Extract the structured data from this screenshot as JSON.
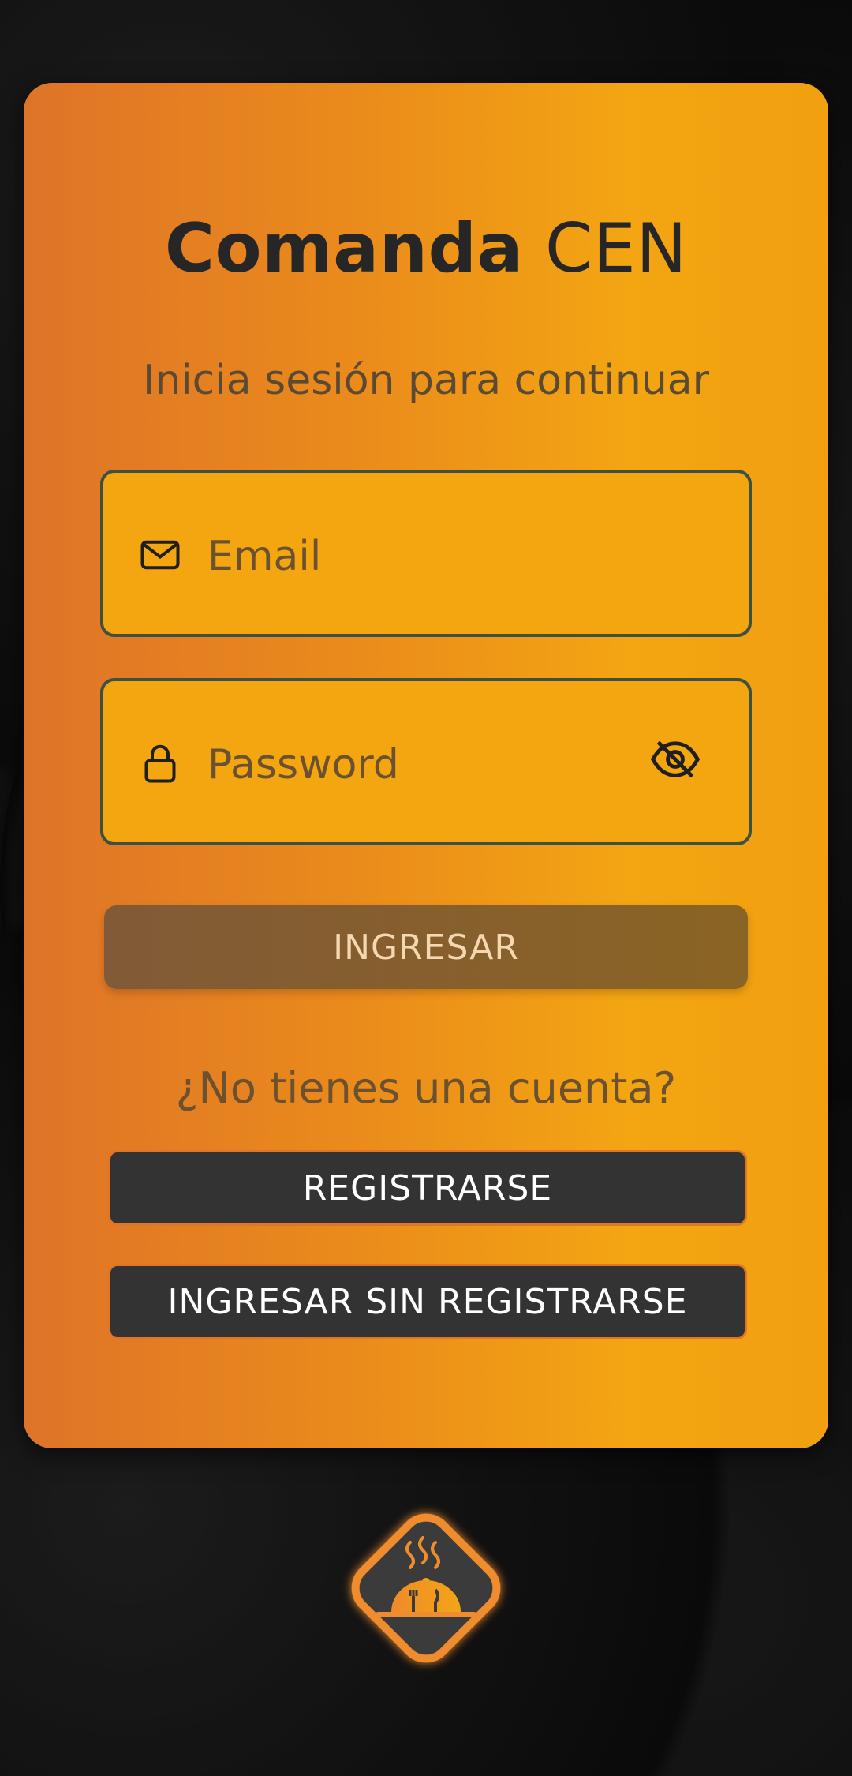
{
  "app": {
    "title_bold": "Comanda",
    "title_light": "CEN",
    "subtitle": "Inicia sesión para continuar"
  },
  "form": {
    "email_placeholder": "Email",
    "password_placeholder": "Password",
    "login_label": "INGRESAR"
  },
  "signup": {
    "question": "¿No tienes una cuenta?",
    "register_label": "REGISTRARSE",
    "guest_label": "INGRESAR SIN REGISTRARSE"
  },
  "icons": {
    "email": "mail-icon",
    "password": "lock-icon",
    "visibility": "eye-off-icon",
    "logo": "serving-dish-logo"
  },
  "colors": {
    "card_left": "#de7428",
    "card_right": "#f1a00f",
    "field_bg": "#f3a610",
    "dark_button": "#333333",
    "accent_orange": "#e0752a"
  }
}
